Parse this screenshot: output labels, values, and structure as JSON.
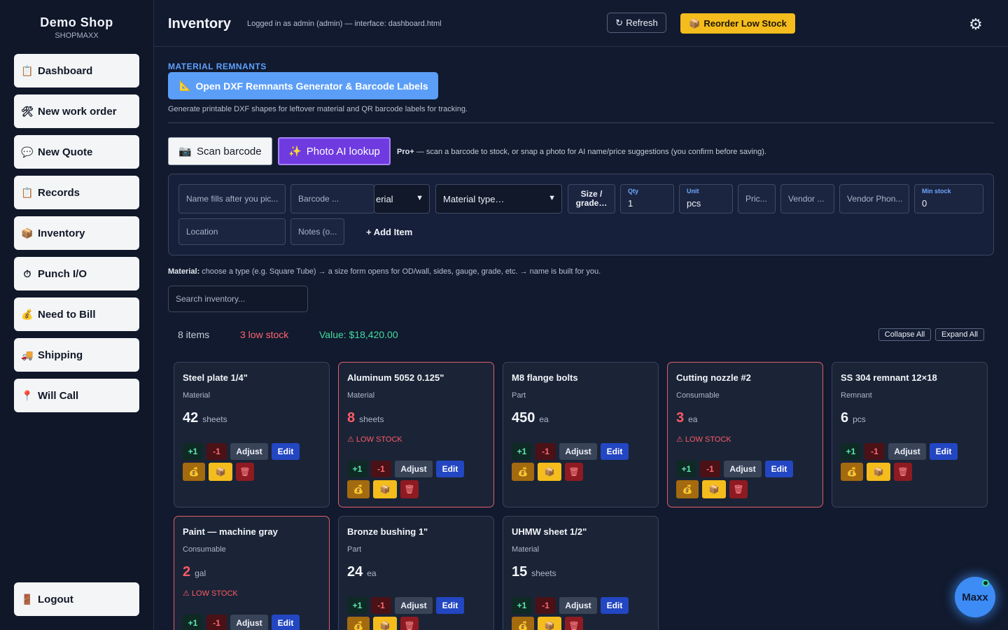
{
  "sidebar": {
    "brand_name": "Demo Shop",
    "brand_sub": "SHOPMAXX",
    "items": [
      {
        "label": "Dashboard",
        "icon": "📋"
      },
      {
        "label": "New work order",
        "icon": "🛠"
      },
      {
        "label": "New Quote",
        "icon": "💬"
      },
      {
        "label": "Records",
        "icon": "📋"
      },
      {
        "label": "Inventory",
        "icon": "📦"
      },
      {
        "label": "Punch I/O",
        "icon": "⏱"
      },
      {
        "label": "Need to Bill",
        "icon": "💰"
      },
      {
        "label": "Shipping",
        "icon": "🚚"
      },
      {
        "label": "Will Call",
        "icon": "📍"
      }
    ],
    "logout": {
      "label": "Logout",
      "icon": "🚪"
    }
  },
  "header": {
    "title": "Inventory",
    "login_info": "Logged in as admin (admin) — interface: dashboard.html",
    "refresh_label": "Refresh",
    "refresh_icon": "↻",
    "reorder_label": "Reorder Low Stock",
    "reorder_icon": "📦",
    "settings_icon": "⚙"
  },
  "remnants": {
    "section_label": "MATERIAL REMNANTS",
    "button_label": "Open DXF Remnants Generator & Barcode Labels",
    "button_icon": "📐",
    "description": "Generate printable DXF shapes for leftover material and QR barcode labels for tracking."
  },
  "scan": {
    "scan_label": "Scan barcode",
    "scan_icon": "📷",
    "photo_label": "Photo AI lookup",
    "photo_icon": "✨",
    "pro_label": "Pro+",
    "pro_note": " — scan a barcode to stock, or snap a photo for AI name/price suggestions (you confirm before saving)."
  },
  "form": {
    "name_placeholder": "Name fills after you pic...",
    "barcode_placeholder": "Barcode ...",
    "material_select": "erial",
    "material_type": "Material type…",
    "size_button": "Size / grade…",
    "qty_label": "Qty",
    "qty_value": "1",
    "unit_label": "Unit",
    "unit_value": "pcs",
    "price_placeholder": "Pric...",
    "vendor_placeholder": "Vendor ...",
    "vendor_phone_placeholder": "Vendor Phon...",
    "min_stock_label": "Min stock",
    "min_stock_value": "0",
    "location_placeholder": "Location",
    "notes_placeholder": "Notes (o...",
    "add_item_label": "+ Add Item"
  },
  "material_note_bold": "Material:",
  "material_note": " choose a type (e.g. Square Tube) → a size form opens for OD/wall, sides, gauge, grade, etc. → name is built for you.",
  "search_placeholder": "Search inventory...",
  "stats": {
    "items": "8 items",
    "low_stock": "3 low stock",
    "value": "Value: $18,420.00"
  },
  "collapse_all": "Collapse All",
  "expand_all": "Expand All",
  "card_buttons": {
    "plus": "+1",
    "minus": "-1",
    "adjust": "Adjust",
    "edit": "Edit",
    "bill_icon": "💰",
    "reorder_icon": "📦",
    "delete_icon": "🗑"
  },
  "low_stock_label": "⚠ LOW STOCK",
  "cards": [
    {
      "name": "Steel plate 1/4\"",
      "category": "Material",
      "qty": "42",
      "unit": "sheets",
      "low": false
    },
    {
      "name": "Aluminum 5052 0.125\"",
      "category": "Material",
      "qty": "8",
      "unit": "sheets",
      "low": true
    },
    {
      "name": "M8 flange bolts",
      "category": "Part",
      "qty": "450",
      "unit": "ea",
      "low": false
    },
    {
      "name": "Cutting nozzle #2",
      "category": "Consumable",
      "qty": "3",
      "unit": "ea",
      "low": true
    },
    {
      "name": "SS 304 remnant 12×18",
      "category": "Remnant",
      "qty": "6",
      "unit": "pcs",
      "low": false
    },
    {
      "name": "Paint — machine gray",
      "category": "Consumable",
      "qty": "2",
      "unit": "gal",
      "low": true
    },
    {
      "name": "Bronze bushing 1\"",
      "category": "Part",
      "qty": "24",
      "unit": "ea",
      "low": false
    },
    {
      "name": "UHMW sheet 1/2\"",
      "category": "Material",
      "qty": "15",
      "unit": "sheets",
      "low": false
    }
  ],
  "assistant": {
    "label": "Maxx"
  }
}
